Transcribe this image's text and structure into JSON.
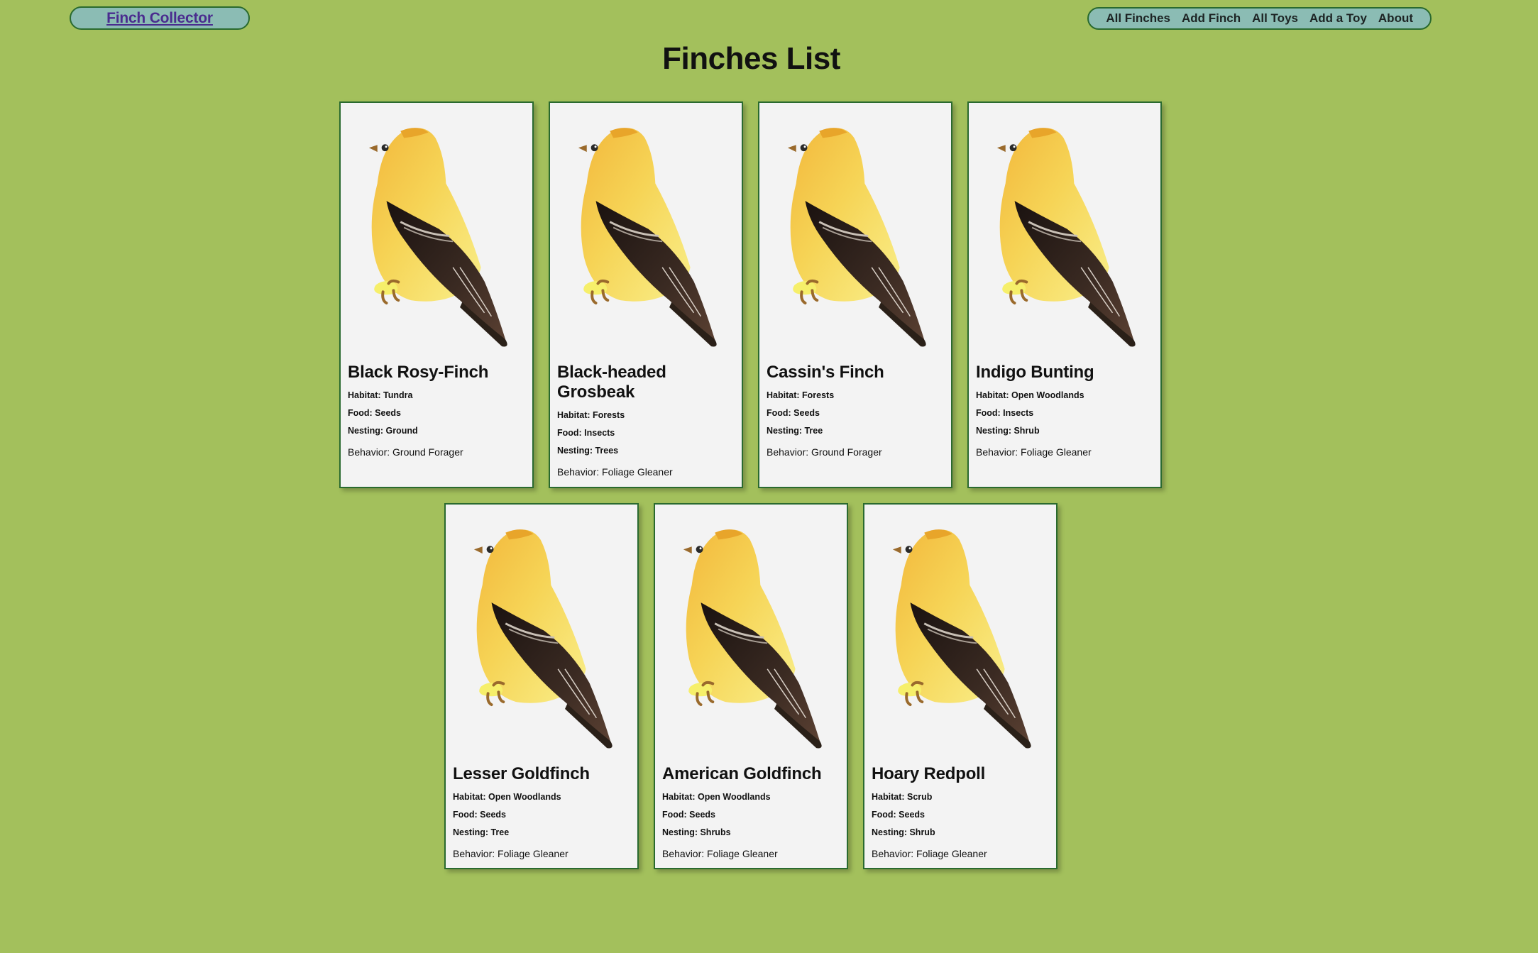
{
  "header": {
    "brand": "Finch Collector",
    "nav": [
      "All Finches",
      "Add Finch",
      "All Toys",
      "Add a Toy",
      "About"
    ]
  },
  "page_title": "Finches List",
  "colors": {
    "background": "#a3c05c",
    "pill": "#8bbcb4",
    "border": "#2a6a2f",
    "card": "#f3f3f3",
    "brand_link": "#4a2c8f"
  },
  "finches": [
    {
      "name": "Black Rosy-Finch",
      "habitat": "Habitat: Tundra",
      "food": "Food: Seeds",
      "nesting": "Nesting: Ground",
      "behavior": "Behavior: Ground Forager"
    },
    {
      "name": "Black-headed Grosbeak",
      "habitat": "Habitat: Forests",
      "food": "Food: Insects",
      "nesting": "Nesting: Trees",
      "behavior": "Behavior: Foliage Gleaner"
    },
    {
      "name": "Cassin's Finch",
      "habitat": "Habitat: Forests",
      "food": "Food: Seeds",
      "nesting": "Nesting: Tree",
      "behavior": "Behavior: Ground Forager"
    },
    {
      "name": "Indigo Bunting",
      "habitat": "Habitat: Open Woodlands",
      "food": "Food: Insects",
      "nesting": "Nesting: Shrub",
      "behavior": "Behavior: Foliage Gleaner"
    },
    {
      "name": "Lesser Goldfinch",
      "habitat": "Habitat: Open Woodlands",
      "food": "Food: Seeds",
      "nesting": "Nesting: Tree",
      "behavior": "Behavior: Foliage Gleaner"
    },
    {
      "name": "American Goldfinch",
      "habitat": "Habitat: Open Woodlands",
      "food": "Food: Seeds",
      "nesting": "Nesting: Shrubs",
      "behavior": "Behavior: Foliage Gleaner"
    },
    {
      "name": "Hoary Redpoll",
      "habitat": "Habitat: Scrub",
      "food": "Food: Seeds",
      "nesting": "Nesting: Shrub",
      "behavior": "Behavior: Foliage Gleaner"
    }
  ]
}
